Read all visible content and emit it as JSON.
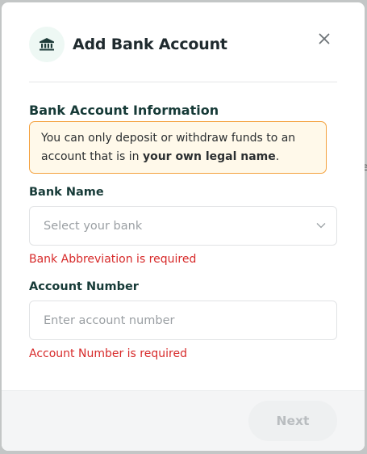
{
  "modal": {
    "title": "Add Bank Account",
    "header_icon": "bank-icon",
    "close_icon": "close-icon"
  },
  "section": {
    "title": "Bank Account Information"
  },
  "notice": {
    "text_before": "You can only deposit or withdraw funds to an account that is in ",
    "text_bold": "your own legal name",
    "text_after": "."
  },
  "bank_name": {
    "label": "Bank Name",
    "placeholder": "Select your bank",
    "value": "",
    "error": "Bank Abbreviation is required"
  },
  "account_number": {
    "label": "Account Number",
    "placeholder": "Enter account number",
    "value": "",
    "error": "Account Number is required"
  },
  "footer": {
    "next_label": "Next"
  },
  "colors": {
    "accent": "#163a37",
    "error": "#d72a2a",
    "notice_border": "#f4a13d",
    "notice_bg": "#fff9ea"
  }
}
